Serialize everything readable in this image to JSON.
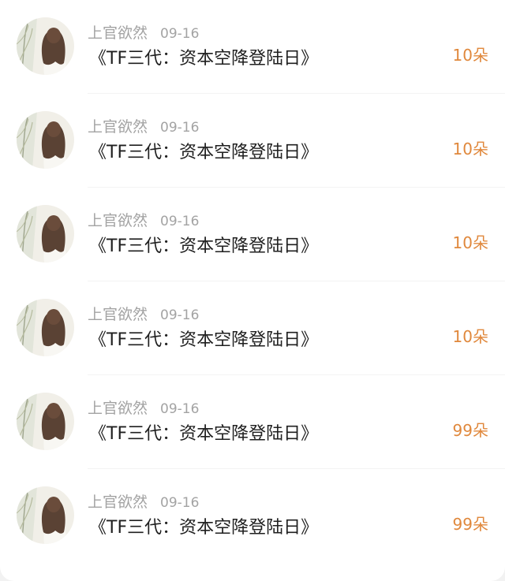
{
  "gift_list": {
    "items": [
      {
        "name": "上官欲然",
        "date": "09-16",
        "title": "《TF三代：资本空降登陆日》",
        "amount": "10朵"
      },
      {
        "name": "上官欲然",
        "date": "09-16",
        "title": "《TF三代：资本空降登陆日》",
        "amount": "10朵"
      },
      {
        "name": "上官欲然",
        "date": "09-16",
        "title": "《TF三代：资本空降登陆日》",
        "amount": "10朵"
      },
      {
        "name": "上官欲然",
        "date": "09-16",
        "title": "《TF三代：资本空降登陆日》",
        "amount": "10朵"
      },
      {
        "name": "上官欲然",
        "date": "09-16",
        "title": "《TF三代：资本空降登陆日》",
        "amount": "99朵"
      },
      {
        "name": "上官欲然",
        "date": "09-16",
        "title": "《TF三代：资本空降登陆日》",
        "amount": "99朵"
      }
    ]
  },
  "colors": {
    "background": "#f2f2f2",
    "card": "#ffffff",
    "name_text": "#a3a3a3",
    "title_text": "#1f1f1f",
    "amount_accent": "#e0883c"
  },
  "icons": {
    "avatar": "user-avatar-photo"
  }
}
